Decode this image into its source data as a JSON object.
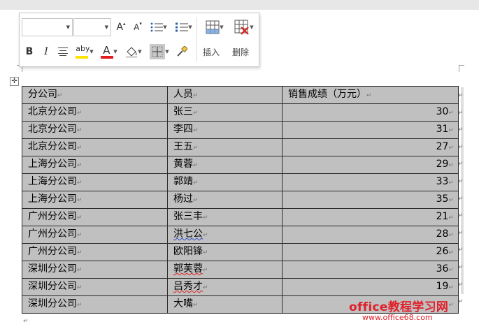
{
  "toolbar": {
    "font_name": "",
    "font_size": "",
    "grow_font": "A",
    "shrink_font": "A",
    "bold": "B",
    "italic": "I",
    "highlight": "aby",
    "font_color": "A",
    "insert_label": "插入",
    "delete_label": "删除",
    "colors": {
      "highlight": "#ffe400",
      "font_color": "#e11d1d",
      "delete_x": "#d9221c"
    }
  },
  "table": {
    "header": [
      "分公司",
      "人员",
      "销售成绩（万元）"
    ],
    "rows": [
      [
        "北京分公司",
        "张三",
        "30"
      ],
      [
        "北京分公司",
        "李四",
        "31"
      ],
      [
        "北京分公司",
        "王五",
        "27"
      ],
      [
        "上海分公司",
        "黄蓉",
        "29"
      ],
      [
        "上海分公司",
        "郭靖",
        "33"
      ],
      [
        "上海分公司",
        "杨过",
        "35"
      ],
      [
        "广州分公司",
        "张三丰",
        "21"
      ],
      [
        "广州分公司",
        "洪七公",
        "28"
      ],
      [
        "广州分公司",
        "欧阳锋",
        "26"
      ],
      [
        "深圳分公司",
        "郭芙蓉",
        "36"
      ],
      [
        "深圳分公司",
        "吕秀才",
        "19"
      ],
      [
        "深圳分公司",
        "大嘴",
        ""
      ]
    ],
    "fill_color": "#c0c0c0"
  },
  "marks": {
    "cell_end": "↵",
    "table_move": "✛"
  },
  "watermark": {
    "title": "office教程学习网",
    "url": "www.office68.com"
  }
}
